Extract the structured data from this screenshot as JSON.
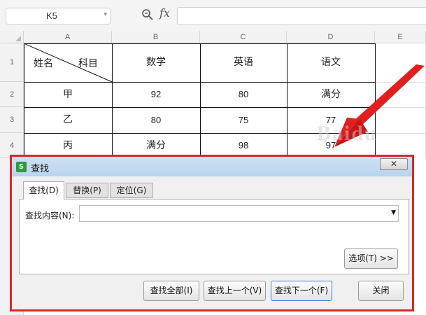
{
  "formula_bar": {
    "cell_ref": "K5",
    "fx_label": "fx",
    "formula_value": ""
  },
  "columns": [
    "A",
    "B",
    "C",
    "D",
    "E"
  ],
  "rows": [
    "1",
    "2",
    "3",
    "4"
  ],
  "table": {
    "corner_left": "姓名",
    "corner_right": "科目",
    "subjects": [
      "数学",
      "英语",
      "语文"
    ],
    "records": [
      {
        "name": "甲",
        "math": "92",
        "english": "80",
        "chinese": "满分"
      },
      {
        "name": "乙",
        "math": "80",
        "english": "75",
        "chinese": "77"
      },
      {
        "name": "丙",
        "math": "满分",
        "english": "98",
        "chinese": "97"
      }
    ]
  },
  "dialog": {
    "app_icon": "S",
    "title": "查找",
    "close_label": "✕",
    "tabs": [
      "查找(D)",
      "替换(P)",
      "定位(G)"
    ],
    "active_tab": 0,
    "find_label": "查找内容(N):",
    "find_value": "",
    "options_button": "选项(T) >>",
    "buttons": {
      "find_all": "查找全部(I)",
      "find_prev": "查找上一个(V)",
      "find_next": "查找下一个(F)",
      "close": "关闭"
    }
  },
  "colors": {
    "highlight": "#d9292b",
    "arrow": "#e02020"
  },
  "icons": [
    "zoom-icon",
    "dropdown-icon",
    "close-icon",
    "app-logo-icon"
  ]
}
